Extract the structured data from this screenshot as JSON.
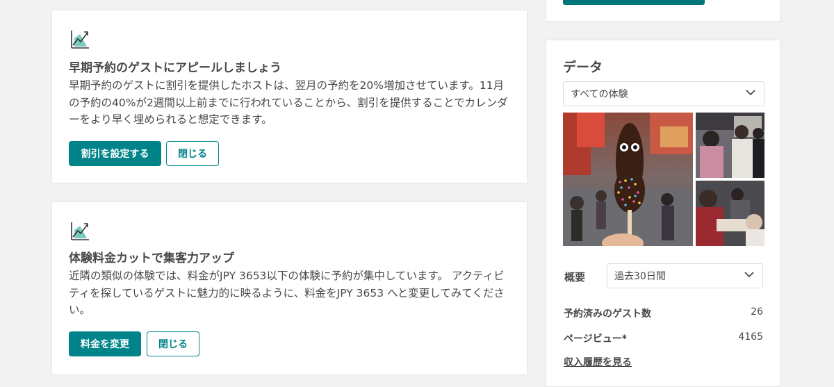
{
  "colors": {
    "accent": "#008489",
    "text": "#484848",
    "background": "#f2f2f2"
  },
  "early_booking_card": {
    "icon": "chart-growth-icon",
    "title": "早期予約のゲストにアピールしましょう",
    "body": "早期予約のゲストに割引を提供したホストは、翌月の予約を20%増加させています。11月の予約の40%が2週間以上前までに行われていることから、割引を提供することでカレンダーをより早く埋められると想定できます。",
    "primary_button": "割引を設定する",
    "dismiss_button": "閉じる"
  },
  "price_card": {
    "icon": "chart-growth-icon",
    "title": "体験料金カットで集客力アップ",
    "body": "近隣の類似の体験では、料金がJPY 3653以下の体験に予約が集中しています。 アクティビティを探しているゲストに魅力的に映るように、料金をJPY 3653 へと変更してみてください。",
    "primary_button": "料金を変更",
    "dismiss_button": "閉じる"
  },
  "data_panel": {
    "title": "データ",
    "experience_select": {
      "value": "すべての体験",
      "icon": "chevron-down-icon"
    },
    "overview_label": "概要",
    "period_select": {
      "value": "過去30日間",
      "icon": "chevron-down-icon"
    },
    "stats": [
      {
        "label": "予約済みのゲスト数",
        "value": "26"
      },
      {
        "label": "ページビュー*",
        "value": "4165"
      }
    ],
    "link": "収入履歴を見る"
  }
}
